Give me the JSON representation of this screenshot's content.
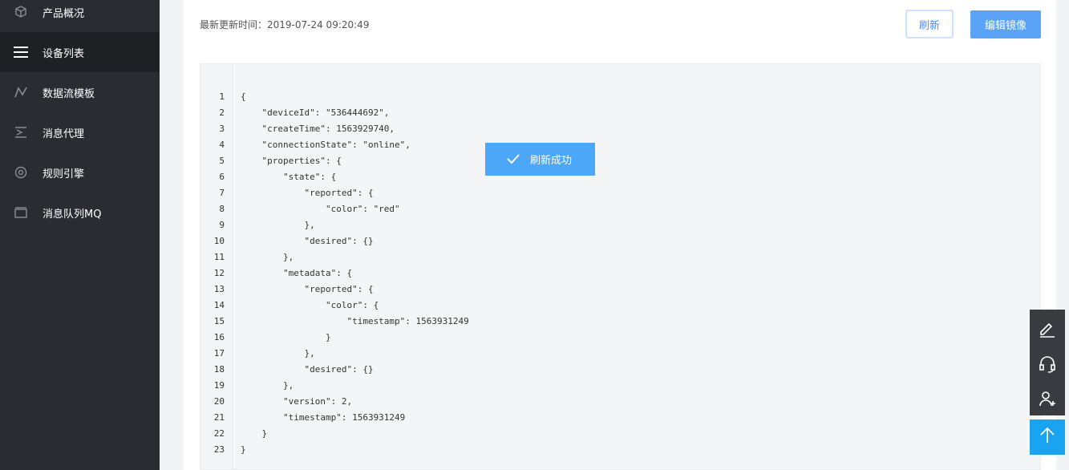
{
  "sidebar": {
    "items": [
      {
        "label": "产品概况",
        "icon": "cube-icon"
      },
      {
        "label": "设备列表",
        "icon": "list-icon"
      },
      {
        "label": "数据流模板",
        "icon": "dataflow-icon"
      },
      {
        "label": "消息代理",
        "icon": "message-proxy-icon"
      },
      {
        "label": "规则引擎",
        "icon": "rule-engine-icon"
      },
      {
        "label": "消息队列MQ",
        "icon": "queue-icon"
      }
    ],
    "active_index": 1
  },
  "header": {
    "update_time": "最新更新时间：2019-07-24 09:20:49",
    "refresh_label": "刷新",
    "edit_label": "编辑镜像"
  },
  "code": {
    "lines": [
      "{",
      "    \"deviceId\": \"536444692\",",
      "    \"createTime\": 1563929740,",
      "    \"connectionState\": \"online\",",
      "    \"properties\": {",
      "        \"state\": {",
      "            \"reported\": {",
      "                \"color\": \"red\"",
      "            },",
      "            \"desired\": {}",
      "        },",
      "        \"metadata\": {",
      "            \"reported\": {",
      "                \"color\": {",
      "                    \"timestamp\": 1563931249",
      "                }",
      "            },",
      "            \"desired\": {}",
      "        },",
      "        \"version\": 2,",
      "        \"timestamp\": 1563931249",
      "    }",
      "}"
    ]
  },
  "toast": {
    "message": "刷新成功",
    "icon": "check-icon"
  },
  "float_tools": [
    {
      "icon": "edit-icon"
    },
    {
      "icon": "headset-icon"
    },
    {
      "icon": "add-user-icon"
    }
  ],
  "back_to_top": {
    "icon": "arrow-up-icon"
  },
  "colors": {
    "sidebar_bg": "#2b2c31",
    "accent": "#4b8ff5",
    "toast_bg": "#4ca7f8",
    "back_top_bg": "#1aa3f0"
  }
}
